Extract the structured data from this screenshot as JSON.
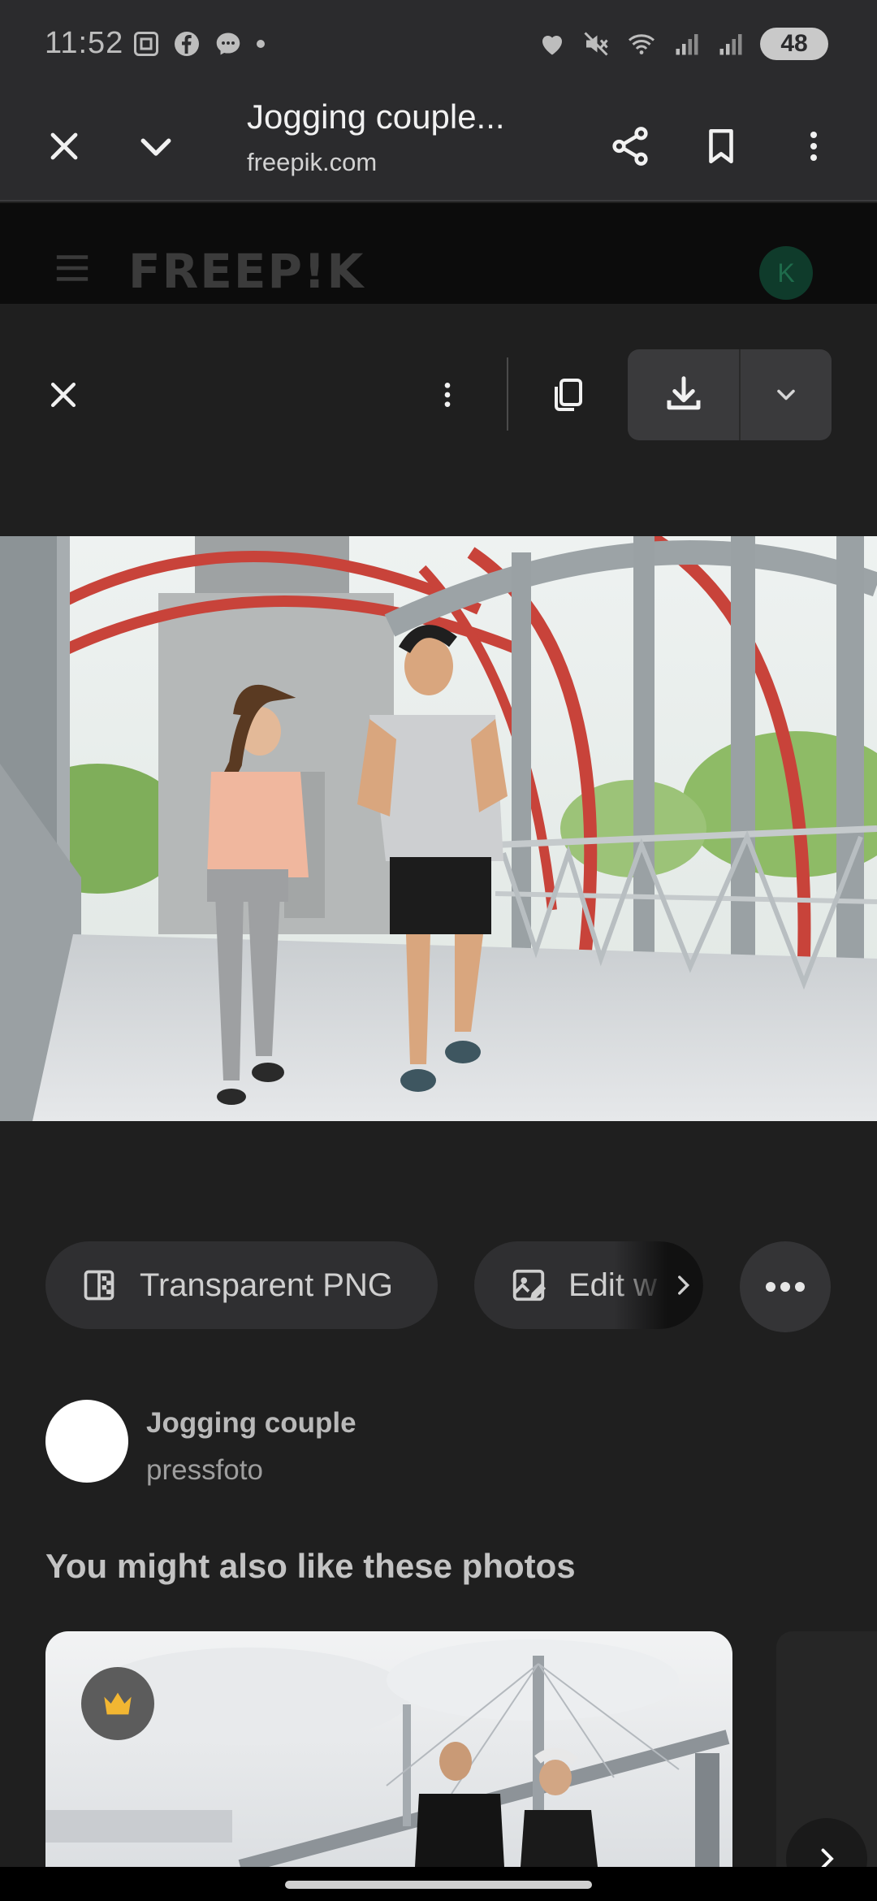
{
  "status_bar": {
    "time": "11:52",
    "battery": "48",
    "icons_left": [
      "screenshot-icon",
      "facebook-icon",
      "messenger-icon",
      "dot-icon"
    ],
    "icons_right": [
      "heart-icon",
      "mute-icon",
      "wifi-icon",
      "signal-icon",
      "signal-icon",
      "battery-icon"
    ]
  },
  "tab_toolbar": {
    "title": "Jogging couple...",
    "url": "freepik.com"
  },
  "site_header": {
    "logo": "FREEP!K",
    "avatar_letter": "K"
  },
  "actions": {
    "transparent_png": "Transparent PNG",
    "edit": "Edit w"
  },
  "author": {
    "title": "Jogging couple",
    "name": "pressfoto"
  },
  "section": {
    "heading": "You might also like these photos"
  },
  "colors": {
    "background": "#1f1f1f",
    "toolbar": "#2b2b2d",
    "chip": "#2f2f31",
    "crown": "#f2b632"
  }
}
